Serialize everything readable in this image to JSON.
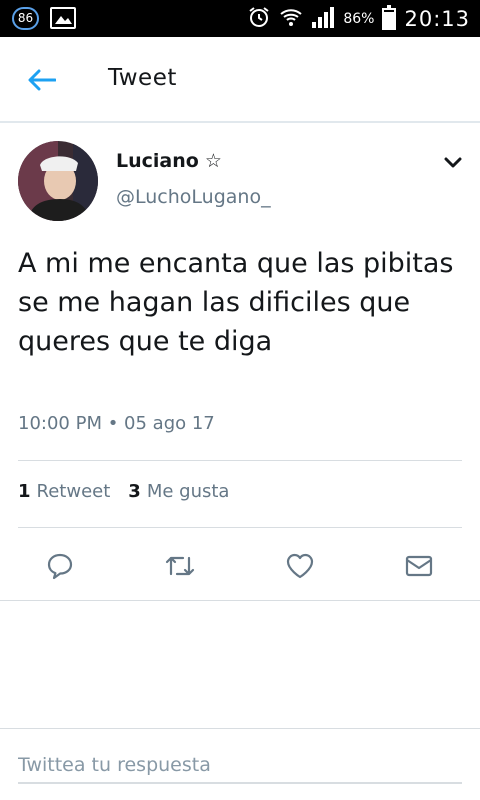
{
  "status_bar": {
    "notification_count": "86",
    "battery_percent": "86%",
    "battery_level": 0.86,
    "time": "20:13",
    "icons": [
      "gallery-icon",
      "alarm-icon",
      "wifi-icon",
      "signal-icon",
      "battery-icon"
    ]
  },
  "header": {
    "back_icon": "arrow-left-icon",
    "title": "Tweet"
  },
  "tweet": {
    "author": {
      "name": "Luciano",
      "name_symbol": "☆",
      "handle": "@LuchoLugano_"
    },
    "text": "A mi me encanta que las pibitas se me hagan las dificiles que queres que te diga",
    "timestamp": "10:00 PM • 05 ago 17",
    "stats": {
      "retweets_count": "1",
      "retweets_label": "Retweet",
      "likes_count": "3",
      "likes_label": "Me gusta"
    },
    "actions": [
      "reply-icon",
      "retweet-icon",
      "like-icon",
      "message-icon"
    ]
  },
  "reply": {
    "placeholder": "Twittea tu respuesta"
  },
  "colors": {
    "accent": "#1da1f2",
    "icon_gray": "#657786",
    "text": "#14171a",
    "divider": "#d8dde1"
  }
}
